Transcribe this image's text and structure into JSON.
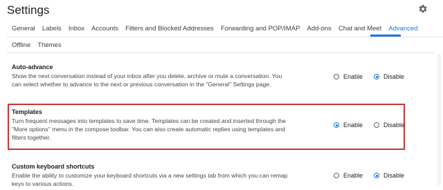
{
  "header": {
    "title": "Settings",
    "settings_icon": "gear-icon"
  },
  "tabs_row1": [
    {
      "label": "General"
    },
    {
      "label": "Labels"
    },
    {
      "label": "Inbox"
    },
    {
      "label": "Accounts"
    },
    {
      "label": "Filters and Blocked Addresses"
    },
    {
      "label": "Forwarding and POP/IMAP"
    },
    {
      "label": "Add-ons"
    },
    {
      "label": "Chat and Meet"
    },
    {
      "label": "Advanced"
    }
  ],
  "tabs_row2": [
    {
      "label": "Offline"
    },
    {
      "label": "Themes"
    }
  ],
  "active_tab": "Advanced",
  "sections": [
    {
      "title": "Auto-advance",
      "description": "Show the next conversation instead of your inbox after you delete, archive or mute a conversation. You can select whether to advance to the next or previous conversation in the \"General\" Settings page.",
      "enable_label": "Enable",
      "disable_label": "Disable",
      "selected": "Disable"
    },
    {
      "title": "Templates",
      "description": "Turn frequent messages into templates to save time. Templates can be created and inserted through the \"More options\" menu in the compose toolbar. You can also create automatic replies using templates and filters together.",
      "enable_label": "Enable",
      "disable_label": "Disable",
      "selected": "Enable"
    },
    {
      "title": "Custom keyboard shortcuts",
      "description": "Enable the ability to customize your keyboard shortcuts via a new settings tab from which you can remap keys to various actions.",
      "enable_label": "Enable",
      "disable_label": "Disable",
      "selected": "Disable"
    }
  ],
  "colors": {
    "accent": "#1a73e8",
    "highlight_border": "#d32f2f"
  }
}
